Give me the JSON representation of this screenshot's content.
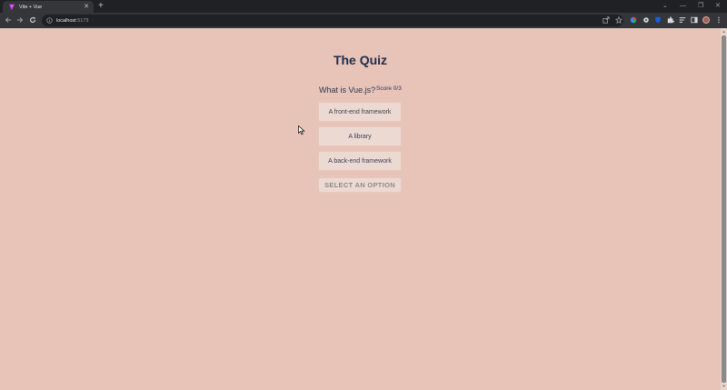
{
  "browser": {
    "tab_title": "Vite + Vue",
    "tab_close": "✕",
    "new_tab": "+",
    "url_host": "localhost",
    "url_port": ":5173",
    "controls": {
      "chevron": "⌄",
      "minimize": "—",
      "restore": "❐",
      "close": "✕"
    }
  },
  "quiz": {
    "title": "The Quiz",
    "question": "What is Vue.js?",
    "score": "Score 0/3",
    "options": [
      {
        "label": "A front-end framework"
      },
      {
        "label": "A library"
      },
      {
        "label": "A back-end framework"
      }
    ],
    "submit_label": "SELECT AN OPTION"
  },
  "colors": {
    "page_background": "#e8c4b8",
    "title": "#1e2d4d",
    "option_background": "#ecd9d2",
    "disabled_text": "#8c8c8c"
  }
}
